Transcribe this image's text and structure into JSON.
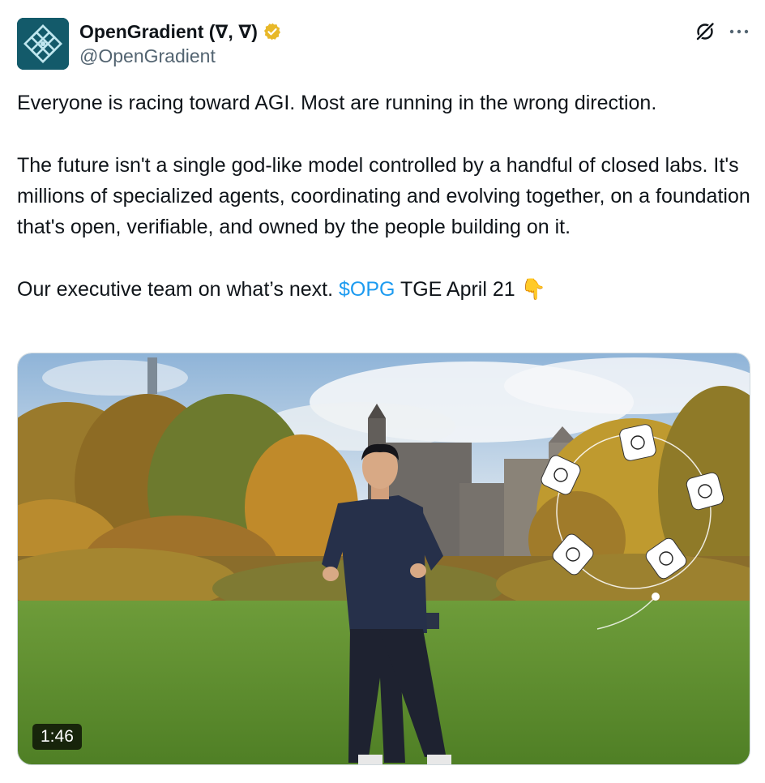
{
  "author": {
    "display_name": "OpenGradient (∇, ∇)",
    "handle": "@OpenGradient",
    "verified": true,
    "avatar_icon": "opengradient-logo",
    "avatar_color": "#135a6a"
  },
  "tweet": {
    "line1": "Everyone is racing toward AGI. Most are running in the wrong direction.",
    "paragraph2": "The future isn't a single god-like model controlled by a handful of closed labs. It's millions of specialized agents, coordinating and evolving together, on a foundation that's open, verifiable, and owned by the people building on it.",
    "line3_prefix": "Our executive team on what’s next. ",
    "cashtag": "$OPG",
    "line3_suffix": " TGE April 21 👇"
  },
  "media": {
    "type": "video",
    "duration": "1:46"
  },
  "actions": {
    "grok_icon": "grok-icon",
    "more_icon": "more-icon"
  },
  "colors": {
    "link": "#1d9bf0",
    "verified_badge": "#e8b829",
    "secondary_text": "#536471"
  }
}
